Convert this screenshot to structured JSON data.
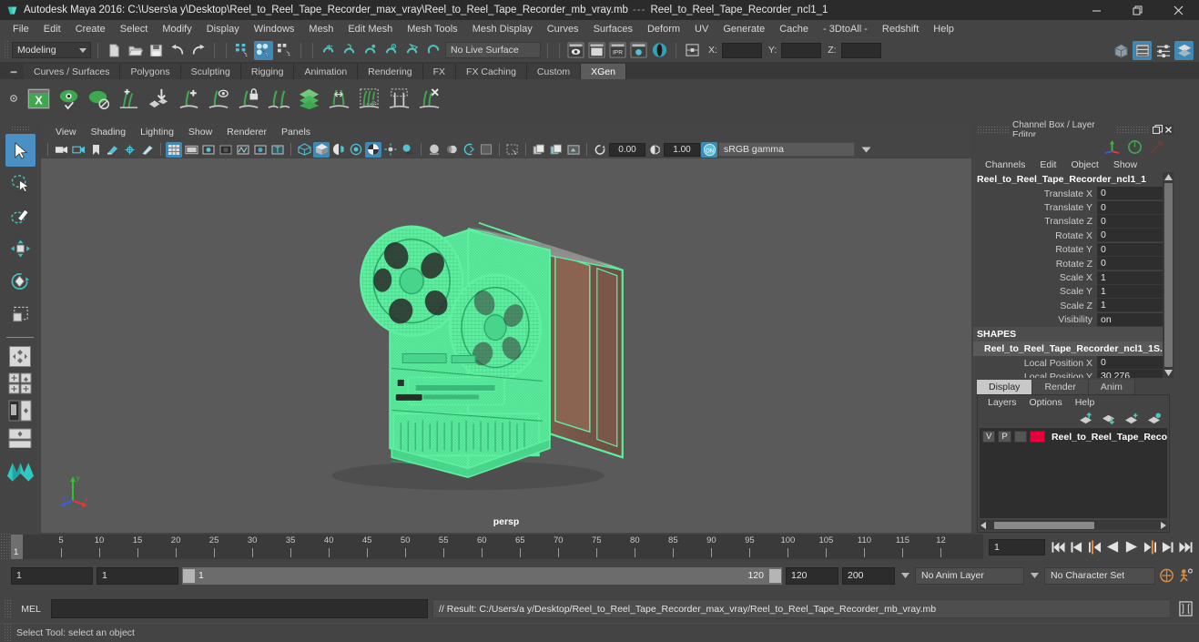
{
  "window": {
    "title": "Autodesk Maya 2016: C:\\Users\\a y\\Desktop\\Reel_to_Reel_Tape_Recorder_max_vray\\Reel_to_Reel_Tape_Recorder_mb_vray.mb",
    "separator": "---",
    "subtitle": "Reel_to_Reel_Tape_Recorder_ncl1_1",
    "minimize": "—",
    "maximize": "❐",
    "close": "✕"
  },
  "menubar": {
    "items": [
      "File",
      "Edit",
      "Create",
      "Select",
      "Modify",
      "Display",
      "Windows",
      "Mesh",
      "Edit Mesh",
      "Mesh Tools",
      "Mesh Display",
      "Curves",
      "Surfaces",
      "Deform",
      "UV",
      "Generate",
      "Cache",
      "- 3DtoAll -",
      "Redshift",
      "Help"
    ]
  },
  "statusline": {
    "mode": "Modeling",
    "live_surface": "No Live Surface",
    "x_label": "X:",
    "y_label": "Y:",
    "z_label": "Z:",
    "x_value": "",
    "y_value": "",
    "z_value": ""
  },
  "shelf": {
    "tabs": [
      "Curves / Surfaces",
      "Polygons",
      "Sculpting",
      "Rigging",
      "Animation",
      "Rendering",
      "FX",
      "FX Caching",
      "Custom",
      "XGen"
    ],
    "active_tab": "XGen",
    "icon_count": 14
  },
  "viewport": {
    "menus": [
      "View",
      "Shading",
      "Lighting",
      "Show",
      "Renderer",
      "Panels"
    ],
    "exposure": "0.00",
    "gamma_value": "1.00",
    "color_space": "sRGB gamma",
    "camera_label": "persp",
    "axis": {
      "x": "x",
      "y": "y",
      "z": "z"
    },
    "selection_color": "#5ef0a0",
    "background_color": "#5a5a5a"
  },
  "channel_box": {
    "panel_title": "Channel Box / Layer Editor",
    "menus": [
      "Channels",
      "Edit",
      "Object",
      "Show"
    ],
    "node_name": "Reel_to_Reel_Tape_Recorder_ncl1_1",
    "attributes": [
      {
        "label": "Translate X",
        "value": "0"
      },
      {
        "label": "Translate Y",
        "value": "0"
      },
      {
        "label": "Translate Z",
        "value": "0"
      },
      {
        "label": "Rotate X",
        "value": "0"
      },
      {
        "label": "Rotate Y",
        "value": "0"
      },
      {
        "label": "Rotate Z",
        "value": "0"
      },
      {
        "label": "Scale X",
        "value": "1"
      },
      {
        "label": "Scale Y",
        "value": "1"
      },
      {
        "label": "Scale Z",
        "value": "1"
      },
      {
        "label": "Visibility",
        "value": "on"
      }
    ],
    "shapes_label": "SHAPES",
    "shape_name": "Reel_to_Reel_Tape_Recorder_ncl1_1S...",
    "shape_attributes": [
      {
        "label": "Local Position X",
        "value": "0"
      },
      {
        "label": "Local Position Y",
        "value": "30.276"
      }
    ]
  },
  "dock_tabs": {
    "items": [
      "Attribute Editor",
      "Channel Box / Layer Editor"
    ],
    "active": "Channel Box / Layer Editor"
  },
  "layer_editor": {
    "tabs": [
      "Display",
      "Render",
      "Anim"
    ],
    "active_tab": "Display",
    "menus": [
      "Layers",
      "Options",
      "Help"
    ],
    "layers": [
      {
        "visibility": "V",
        "playback": "P",
        "shading": "",
        "color": "#e8003c",
        "name": "Reel_to_Reel_Tape_Reco"
      }
    ]
  },
  "timeline": {
    "current_frame": "1",
    "current_frame_field": "1",
    "tick_labels": [
      "5",
      "10",
      "15",
      "20",
      "25",
      "30",
      "35",
      "40",
      "45",
      "50",
      "55",
      "60",
      "65",
      "70",
      "75",
      "80",
      "85",
      "90",
      "95",
      "100",
      "105",
      "110",
      "115",
      "12"
    ],
    "start_field": "1",
    "end_field": "1",
    "range_start": "1",
    "range_end": "120",
    "playback_end": "120",
    "anim_end": "200",
    "anim_layer": "No Anim Layer",
    "character_set": "No Character Set"
  },
  "command_line": {
    "label": "MEL",
    "input_value": "",
    "result": "// Result: C:/Users/a y/Desktop/Reel_to_Reel_Tape_Recorder_max_vray/Reel_to_Reel_Tape_Recorder_mb_vray.mb"
  },
  "help_line": {
    "text": "Select Tool: select an object"
  }
}
